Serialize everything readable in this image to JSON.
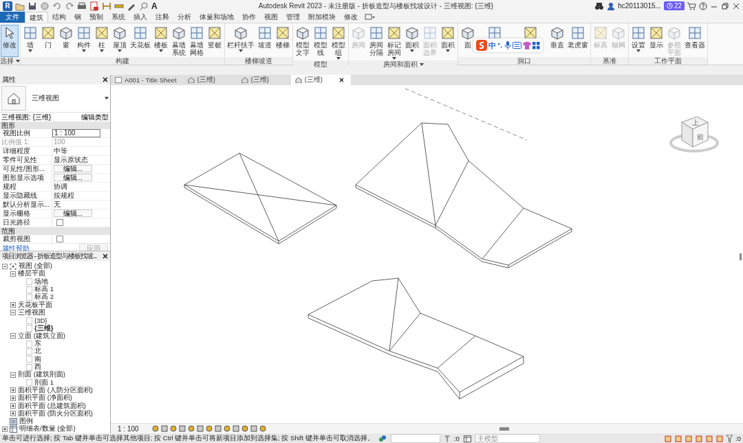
{
  "title_bar": {
    "logo": "R",
    "text_tool": "A",
    "title": "Autodesk Revit 2023 - 未注册版 - 折板造型与楼板找坡设计 - 三维视图: {三维}",
    "user": "hc20113015...",
    "badge": "22"
  },
  "menu_tabs": [
    {
      "label": "文件",
      "kind": "app",
      "selected": false
    },
    {
      "label": "建筑",
      "kind": "tab",
      "selected": true
    },
    {
      "label": "结构",
      "kind": "tab",
      "selected": false
    },
    {
      "label": "钢",
      "kind": "tab",
      "selected": false
    },
    {
      "label": "预制",
      "kind": "tab",
      "selected": false
    },
    {
      "label": "系统",
      "kind": "tab",
      "selected": false
    },
    {
      "label": "插入",
      "kind": "tab",
      "selected": false
    },
    {
      "label": "注释",
      "kind": "tab",
      "selected": false
    },
    {
      "label": "分析",
      "kind": "tab",
      "selected": false
    },
    {
      "label": "体量和场地",
      "kind": "tab",
      "selected": false
    },
    {
      "label": "协作",
      "kind": "tab",
      "selected": false
    },
    {
      "label": "视图",
      "kind": "tab",
      "selected": false
    },
    {
      "label": "管理",
      "kind": "tab",
      "selected": false
    },
    {
      "label": "附加模块",
      "kind": "tab",
      "selected": false
    },
    {
      "label": "修改",
      "kind": "tab",
      "selected": false
    }
  ],
  "ribbon": [
    {
      "title": "选择",
      "menu": true,
      "buttons": [
        {
          "label": "修改",
          "kind": "select",
          "dropdown": false,
          "disabled": false,
          "active": true
        }
      ]
    },
    {
      "title": "构建",
      "menu": false,
      "buttons": [
        {
          "label": "墙",
          "kind": "tool",
          "dropdown": true,
          "disabled": false,
          "active": false
        },
        {
          "label": "门",
          "kind": "tool",
          "dropdown": false,
          "disabled": false,
          "active": false
        },
        {
          "label": "窗",
          "kind": "tool",
          "dropdown": false,
          "disabled": false,
          "active": false
        },
        {
          "label": "构件",
          "kind": "tool",
          "dropdown": true,
          "disabled": false,
          "active": false
        },
        {
          "label": "柱",
          "kind": "tool",
          "dropdown": true,
          "disabled": false,
          "active": false
        },
        {
          "label": "屋顶",
          "kind": "tool",
          "dropdown": true,
          "disabled": false,
          "active": false
        },
        {
          "label": "天花板",
          "kind": "tool",
          "dropdown": false,
          "disabled": false,
          "active": false
        },
        {
          "label": "楼板",
          "kind": "tool",
          "dropdown": true,
          "disabled": false,
          "active": false
        },
        {
          "label": "幕墙系统",
          "kind": "compact",
          "dropdown": false,
          "disabled": false,
          "active": false
        },
        {
          "label": "幕墙网格",
          "kind": "compact",
          "dropdown": false,
          "disabled": false,
          "active": false
        },
        {
          "label": "竖梃",
          "kind": "tool",
          "dropdown": false,
          "disabled": false,
          "active": false
        }
      ]
    },
    {
      "title": "楼梯坡道",
      "menu": false,
      "buttons": [
        {
          "label": "栏杆扶手",
          "kind": "tool",
          "dropdown": true,
          "disabled": false,
          "active": false
        },
        {
          "label": "坡道",
          "kind": "tool",
          "dropdown": false,
          "disabled": false,
          "active": false
        },
        {
          "label": "楼梯",
          "kind": "tool",
          "dropdown": false,
          "disabled": false,
          "active": false
        }
      ]
    },
    {
      "title": "模型",
      "menu": false,
      "buttons": [
        {
          "label": "模型文字",
          "kind": "compact",
          "dropdown": false,
          "disabled": false,
          "active": false
        },
        {
          "label": "模型线",
          "kind": "compact",
          "dropdown": false,
          "disabled": false,
          "active": false
        },
        {
          "label": "模型组",
          "kind": "compact",
          "dropdown": true,
          "disabled": false,
          "active": false
        }
      ]
    },
    {
      "title": "房间和面积",
      "menu": true,
      "buttons": [
        {
          "label": "房间",
          "kind": "tool",
          "dropdown": false,
          "disabled": true,
          "active": false
        },
        {
          "label": "房间分隔",
          "kind": "compact",
          "dropdown": false,
          "disabled": false,
          "active": false
        },
        {
          "label": "标记房间",
          "kind": "compact",
          "dropdown": true,
          "disabled": false,
          "active": false
        },
        {
          "label": "面积",
          "kind": "tool",
          "dropdown": true,
          "disabled": false,
          "active": false
        },
        {
          "label": "面积边界",
          "kind": "compact",
          "dropdown": false,
          "disabled": true,
          "active": false
        },
        {
          "label": "面积",
          "kind": "tool",
          "dropdown": true,
          "disabled": false,
          "active": false
        }
      ]
    },
    {
      "title": "洞口",
      "menu": false,
      "buttons": [
        {
          "label": "面",
          "kind": "tool",
          "dropdown": false,
          "disabled": false,
          "active": false
        },
        {
          "kind": "tool",
          "disabled": false,
          "active": false
        },
        {
          "kind": "tool",
          "disabled": false,
          "active": false
        },
        {
          "label": "垂直",
          "kind": "tool",
          "dropdown": false,
          "disabled": false,
          "active": false
        },
        {
          "label": "老虎窗",
          "kind": "tool",
          "dropdown": false,
          "disabled": false,
          "active": false
        }
      ]
    },
    {
      "title": "基准",
      "menu": false,
      "buttons": [
        {
          "label": "标高",
          "kind": "tool",
          "dropdown": false,
          "disabled": true,
          "active": false
        },
        {
          "label": "轴网",
          "kind": "tool",
          "dropdown": false,
          "disabled": true,
          "active": false
        }
      ]
    },
    {
      "title": "工作平面",
      "menu": false,
      "buttons": [
        {
          "label": "设置",
          "kind": "tool",
          "dropdown": true,
          "disabled": false,
          "active": false
        },
        {
          "label": "显示",
          "kind": "tool",
          "dropdown": false,
          "disabled": false,
          "active": false
        },
        {
          "label": "参照平面",
          "kind": "compact",
          "dropdown": false,
          "disabled": true,
          "active": false
        },
        {
          "label": "查看器",
          "kind": "tool",
          "dropdown": false,
          "disabled": false,
          "active": false
        }
      ]
    }
  ],
  "ime_toolbar": {
    "mode": "中"
  },
  "properties": {
    "title": "属性",
    "type_name": "三维视图",
    "selector": "三维视图: {三维}",
    "edit_type": "编辑类型",
    "groups": [
      {
        "title": "图形",
        "rows": [
          {
            "label": "视图比例",
            "value": "1 : 100",
            "kind": "field"
          },
          {
            "label": "比例值 1:",
            "value": "100",
            "kind": "readonly"
          },
          {
            "label": "详细程度",
            "value": "中等",
            "kind": "text"
          },
          {
            "label": "零件可见性",
            "value": "显示原状态",
            "kind": "text"
          },
          {
            "label": "可见性/图形...",
            "value": "编辑...",
            "kind": "button"
          },
          {
            "label": "图形显示选项",
            "value": "编辑...",
            "kind": "button"
          },
          {
            "label": "规程",
            "value": "协调",
            "kind": "text"
          },
          {
            "label": "显示隐藏线",
            "value": "按规程",
            "kind": "text"
          },
          {
            "label": "默认分析显示...",
            "value": "无",
            "kind": "text"
          },
          {
            "label": "显示栅格",
            "value": "编辑...",
            "kind": "button"
          },
          {
            "label": "日光路径",
            "kind": "checkbox",
            "checked": false
          }
        ]
      },
      {
        "title": "范围",
        "rows": [
          {
            "label": "裁剪视图",
            "kind": "checkbox",
            "checked": false
          }
        ]
      }
    ],
    "help_link": "属性帮助",
    "apply": "应用"
  },
  "project_browser": {
    "title": "项目浏览器 - 折板造型与楼板找坡...",
    "tree": [
      {
        "label": "视图 (全部)",
        "kind": "root",
        "expanded": true,
        "children": [
          {
            "label": "楼层平面",
            "kind": "group",
            "expanded": true,
            "children": [
              {
                "label": "场地",
                "kind": "view",
                "current": false
              },
              {
                "label": "标高 1",
                "kind": "view",
                "current": false
              },
              {
                "label": "标高 2",
                "kind": "view",
                "current": false
              }
            ]
          },
          {
            "label": "天花板平面",
            "kind": "group",
            "expanded": false
          },
          {
            "label": "三维视图",
            "kind": "group",
            "expanded": true,
            "children": [
              {
                "label": "{3D}",
                "kind": "view",
                "current": false
              },
              {
                "label": "{三维}",
                "kind": "view",
                "current": true
              }
            ]
          },
          {
            "label": "立面 (建筑立面)",
            "kind": "group",
            "expanded": true,
            "children": [
              {
                "label": "东",
                "kind": "view",
                "current": false
              },
              {
                "label": "北",
                "kind": "view",
                "current": false
              },
              {
                "label": "南",
                "kind": "view",
                "current": false
              },
              {
                "label": "西",
                "kind": "view",
                "current": false
              }
            ]
          },
          {
            "label": "剖面 (建筑剖面)",
            "kind": "group",
            "expanded": true,
            "children": [
              {
                "label": "剖面 1",
                "kind": "view",
                "current": false
              }
            ]
          },
          {
            "label": "面积平面 (人防分区面积)",
            "kind": "group",
            "expanded": false
          },
          {
            "label": "面积平面 (净面积)",
            "kind": "group",
            "expanded": false
          },
          {
            "label": "面积平面 (总建筑面积)",
            "kind": "group",
            "expanded": false
          },
          {
            "label": "面积平面 (防火分区面积)",
            "kind": "group",
            "expanded": false
          }
        ]
      },
      {
        "label": "图例",
        "kind": "legend"
      },
      {
        "label": "明细表/数量 (全部)",
        "kind": "schedule",
        "expanded": false
      }
    ]
  },
  "view_tabs": [
    {
      "label": "A001 - Title Sheet",
      "kind": "sheet",
      "selected": false
    },
    {
      "label": "{三维}",
      "kind": "model",
      "selected": false
    },
    {
      "label": "{三维}",
      "kind": "model",
      "selected": false
    },
    {
      "label": "{三维}",
      "kind": "model",
      "selected": true
    }
  ],
  "view_cube": {
    "top": "上",
    "front": "前"
  },
  "view_bar": {
    "scale": "1 : 100"
  },
  "status_bar": {
    "message": "单击可进行选择; 按 Tab 键并单击可选择其他项目; 按 Ctrl 键并单击可将新项目添加到选择集; 按 Shift 键并单击可取消选择。",
    "select_count": ":0",
    "workset": "主模型",
    "filter_count": ":0"
  }
}
